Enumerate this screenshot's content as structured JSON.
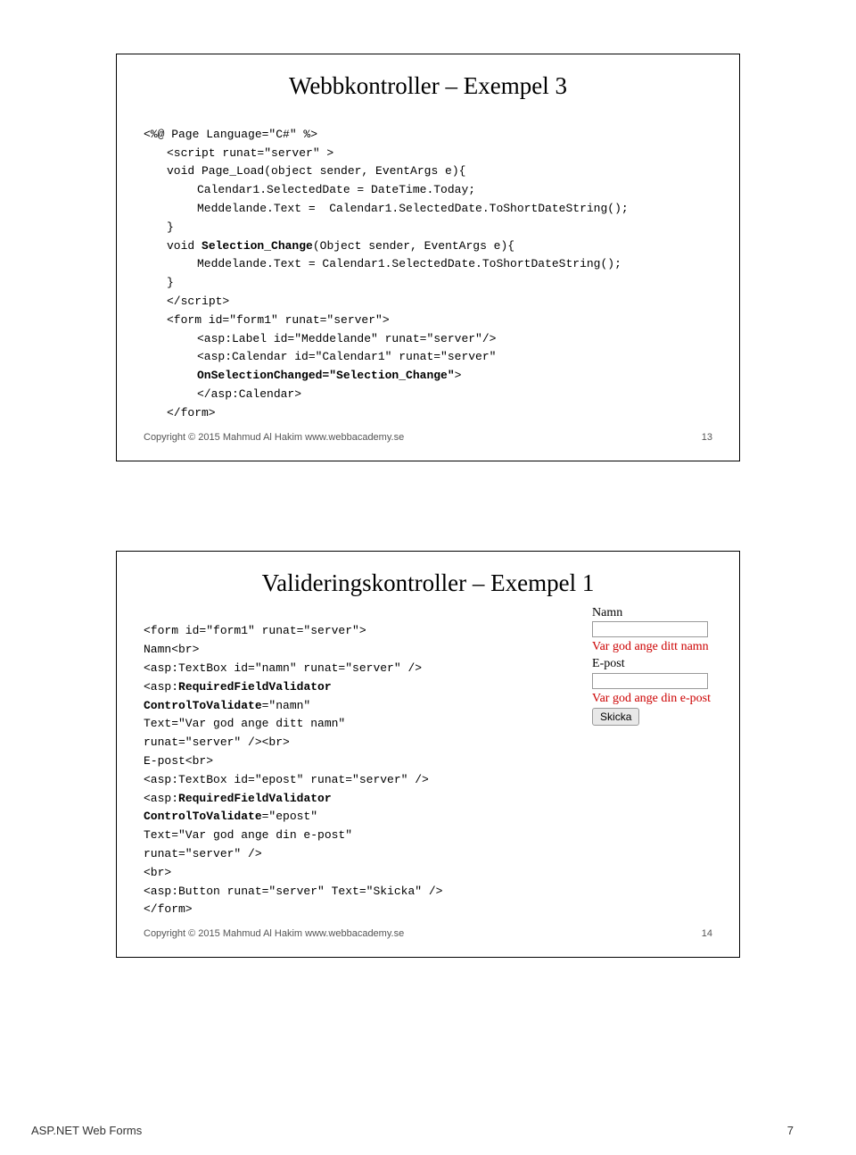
{
  "slide1": {
    "title": "Webbkontroller – Exempel 3",
    "code": {
      "l1": "<%@ Page Language=\"C#\" %>",
      "l2": "<script runat=\"server\" >",
      "l3": "void Page_Load(object sender, EventArgs e){",
      "l4": "Calendar1.SelectedDate = DateTime.Today;",
      "l5": "Meddelande.Text =  Calendar1.SelectedDate.ToShortDateString();",
      "l6": "}",
      "l7a": "void ",
      "l7b": "Selection_Change",
      "l7c": "(Object sender, EventArgs e){",
      "l8": "Meddelande.Text = Calendar1.SelectedDate.ToShortDateString();",
      "l9": "}",
      "l10": "</scr",
      "l10b": "ipt>",
      "l11": "<form id=\"form1\" runat=\"server\">",
      "l12": "<asp:Label id=\"Meddelande\" runat=\"server\"/>",
      "l13": "<asp:Calendar id=\"Calendar1\" runat=\"server\"",
      "l14": "OnSelectionChanged=\"Selection_Change\"",
      "l14b": ">",
      "l15": "</asp:Calendar>",
      "l16": "</form>"
    },
    "copyright": "Copyright © 2015 Mahmud Al Hakim www.webbacademy.se",
    "page_num": "13"
  },
  "slide2": {
    "title": "Valideringskontroller – Exempel 1",
    "code": {
      "l1": "<form id=\"form1\" runat=\"server\">",
      "l2": "Namn<br>",
      "l3": "<asp:TextBox id=\"namn\" runat=\"server\" />",
      "l4a": "<asp:",
      "l4b": "RequiredFieldValidator",
      "l5": "ControlToValidate",
      "l5b": "=\"namn\"",
      "l6": "Text=\"Var god ange ditt namn\"",
      "l7": "runat=\"server\" /><br>",
      "l8": "E-post<br>",
      "l9": "<asp:TextBox id=\"epost\" runat=\"server\" />",
      "l10a": "<asp:",
      "l10b": "RequiredFieldValidator",
      "l11": "ControlToValidate",
      "l11b": "=\"epost\"",
      "l12": "Text=\"Var god ange din e-post\"",
      "l13": "runat=\"server\" />",
      "l14": "<br>",
      "l15": "<asp:Button runat=\"server\" Text=\"Skicka\" />",
      "l16": "</form>"
    },
    "copyright": "Copyright © 2015 Mahmud Al Hakim www.webbacademy.se",
    "page_num": "14",
    "demo": {
      "label_name": "Namn",
      "err_name": "Var god ange ditt namn",
      "label_email": "E-post",
      "err_email": "Var god ange din e-post",
      "button": "Skicka"
    }
  },
  "footer": {
    "title": "ASP.NET Web Forms",
    "page": "7"
  }
}
